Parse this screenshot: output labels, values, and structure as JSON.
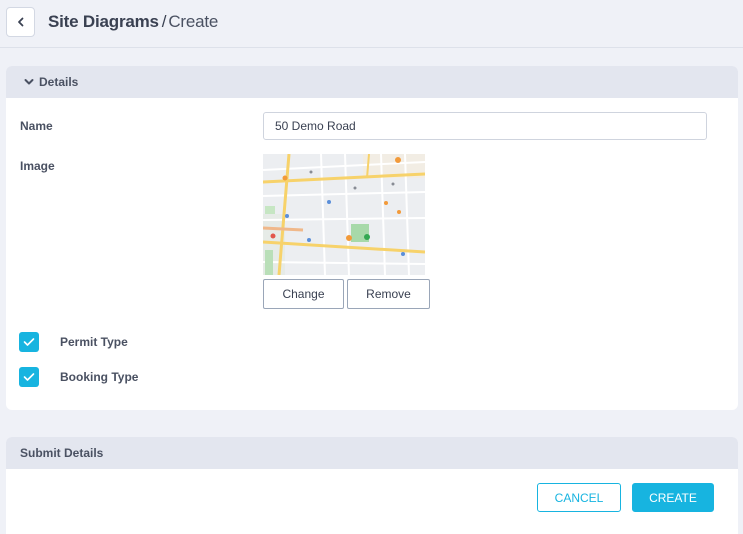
{
  "header": {
    "breadcrumb_main": "Site Diagrams",
    "breadcrumb_separator": "/",
    "breadcrumb_current": "Create",
    "back_icon": "chevron-left-icon"
  },
  "details": {
    "title": "Details",
    "toggle_icon": "chevron-down-icon",
    "name_label": "Name",
    "name_value": "50 Demo Road",
    "image_label": "Image",
    "map_image": "map-thumbnail",
    "change_label": "Change",
    "remove_label": "Remove",
    "checkboxes": [
      {
        "label": "Permit Type",
        "checked": true
      },
      {
        "label": "Booking Type",
        "checked": true
      }
    ]
  },
  "submit": {
    "title": "Submit Details",
    "cancel_label": "CANCEL",
    "create_label": "CREATE"
  },
  "colors": {
    "accent": "#17b4e0",
    "background": "#eff1f7",
    "section_header": "#e3e6ef"
  }
}
